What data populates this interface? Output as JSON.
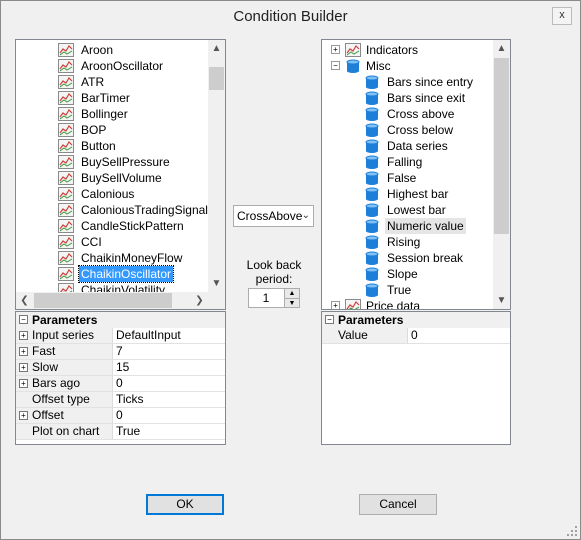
{
  "window": {
    "title": "Condition Builder",
    "close_glyph": "x"
  },
  "left_tree": {
    "items": [
      {
        "label": "Aroon",
        "icon": "indicator-chart-icon",
        "selected": false
      },
      {
        "label": "AroonOscillator",
        "icon": "indicator-chart-icon",
        "selected": false
      },
      {
        "label": "ATR",
        "icon": "indicator-chart-icon",
        "selected": false
      },
      {
        "label": "BarTimer",
        "icon": "indicator-chart-icon",
        "selected": false
      },
      {
        "label": "Bollinger",
        "icon": "indicator-chart-icon",
        "selected": false
      },
      {
        "label": "BOP",
        "icon": "indicator-chart-icon",
        "selected": false
      },
      {
        "label": "Button",
        "icon": "indicator-chart-icon",
        "selected": false
      },
      {
        "label": "BuySellPressure",
        "icon": "indicator-chart-icon",
        "selected": false
      },
      {
        "label": "BuySellVolume",
        "icon": "indicator-chart-icon",
        "selected": false
      },
      {
        "label": "Calonious",
        "icon": "indicator-chart-icon",
        "selected": false
      },
      {
        "label": "CaloniousTradingSignals",
        "icon": "indicator-chart-icon",
        "selected": false
      },
      {
        "label": "CandleStickPattern",
        "icon": "indicator-chart-icon",
        "selected": false
      },
      {
        "label": "CCI",
        "icon": "indicator-chart-icon",
        "selected": false
      },
      {
        "label": "ChaikinMoneyFlow",
        "icon": "indicator-chart-icon",
        "selected": false
      },
      {
        "label": "ChaikinOscillator",
        "icon": "indicator-chart-icon",
        "selected": true
      },
      {
        "label": "ChaikinVolatility",
        "icon": "indicator-chart-icon",
        "selected": false
      }
    ]
  },
  "left_params": {
    "header": "Parameters",
    "rows": [
      {
        "name": "Input series",
        "value": "DefaultInput",
        "expandable": true
      },
      {
        "name": "Fast",
        "value": "7",
        "expandable": true
      },
      {
        "name": "Slow",
        "value": "15",
        "expandable": true
      },
      {
        "name": "Bars ago",
        "value": "0",
        "expandable": true
      },
      {
        "name": "Offset type",
        "value": "Ticks",
        "expandable": false
      },
      {
        "name": "Offset",
        "value": "0",
        "expandable": true
      },
      {
        "name": "Plot on chart",
        "value": "True",
        "expandable": false
      }
    ]
  },
  "middle": {
    "operator": "CrossAbove",
    "lookback_label_1": "Look back",
    "lookback_label_2": "period:",
    "lookback_value": "1"
  },
  "right_tree": {
    "groups": [
      {
        "label": "Indicators",
        "expander": "+",
        "icon": "indicator-chart-icon"
      },
      {
        "label": "Misc",
        "expander": "−",
        "icon": "database-icon"
      }
    ],
    "misc_items": [
      {
        "label": "Bars since entry",
        "selected": false
      },
      {
        "label": "Bars since exit",
        "selected": false
      },
      {
        "label": "Cross above",
        "selected": false
      },
      {
        "label": "Cross below",
        "selected": false
      },
      {
        "label": "Data series",
        "selected": false
      },
      {
        "label": "Falling",
        "selected": false
      },
      {
        "label": "False",
        "selected": false
      },
      {
        "label": "Highest bar",
        "selected": false
      },
      {
        "label": "Lowest bar",
        "selected": false
      },
      {
        "label": "Numeric value",
        "selected": true
      },
      {
        "label": "Rising",
        "selected": false
      },
      {
        "label": "Session break",
        "selected": false
      },
      {
        "label": "Slope",
        "selected": false
      },
      {
        "label": "True",
        "selected": false
      }
    ],
    "partial_group": {
      "label": "Price data",
      "expander": "+"
    }
  },
  "right_params": {
    "header": "Parameters",
    "rows": [
      {
        "name": "Value",
        "value": "0"
      }
    ]
  },
  "buttons": {
    "ok": "OK",
    "cancel": "Cancel"
  },
  "colors": {
    "selection": "#3399ff",
    "window_bg": "#f0f0f0",
    "focus_border": "#0078d7"
  }
}
